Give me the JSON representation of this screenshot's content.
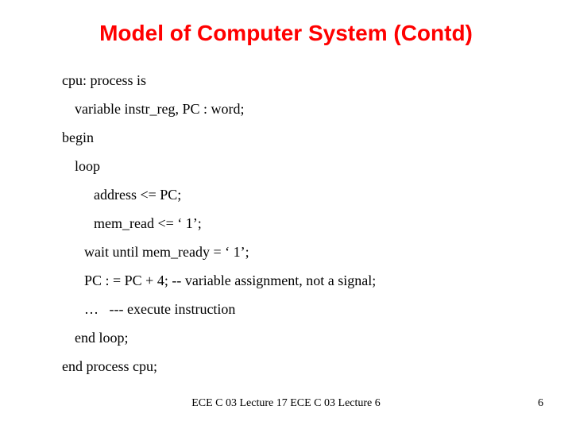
{
  "title": "Model of Computer System (Contd)",
  "code": {
    "l0": "cpu: process is",
    "l1": "variable instr_reg, PC : word;",
    "l2": "begin",
    "l3": "loop",
    "l4": "address <= PC;",
    "l5": "mem_read <= ‘ 1’;",
    "l6": "wait until mem_ready = ‘ 1’;",
    "l7": "PC : = PC + 4; -- variable assignment, not a signal;",
    "l8": "…   --- execute instruction",
    "l9": "end loop;",
    "l10": "end process cpu;"
  },
  "footer": "ECE C 03 Lecture 17 ECE C 03 Lecture 6",
  "page_number": "6"
}
